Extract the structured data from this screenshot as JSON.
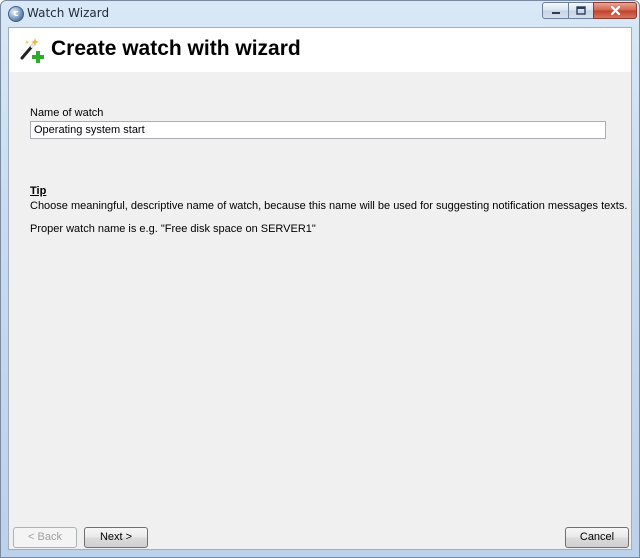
{
  "window": {
    "title": "Watch Wizard",
    "icon": "app-logo-icon",
    "controls": {
      "minimize": "minimize-icon",
      "maximize": "maximize-icon",
      "close": "close-icon"
    }
  },
  "header": {
    "icon": "wizard-wand-icon",
    "title": "Create watch with wizard"
  },
  "form": {
    "name_label": "Name of watch",
    "name_value": "Operating system start"
  },
  "tip": {
    "heading": "Tip",
    "line1": "Choose meaningful, descriptive name of watch, because this name will be used for suggesting notification messages texts.",
    "line2": "Proper watch name is e.g. \"Free disk space on SERVER1\""
  },
  "buttons": {
    "back": "< Back",
    "back_enabled": false,
    "next": "Next >",
    "cancel": "Cancel"
  },
  "colors": {
    "content_bg": "#f0f0f0",
    "header_bg": "#ffffff",
    "plus_green": "#2eaa2e"
  }
}
